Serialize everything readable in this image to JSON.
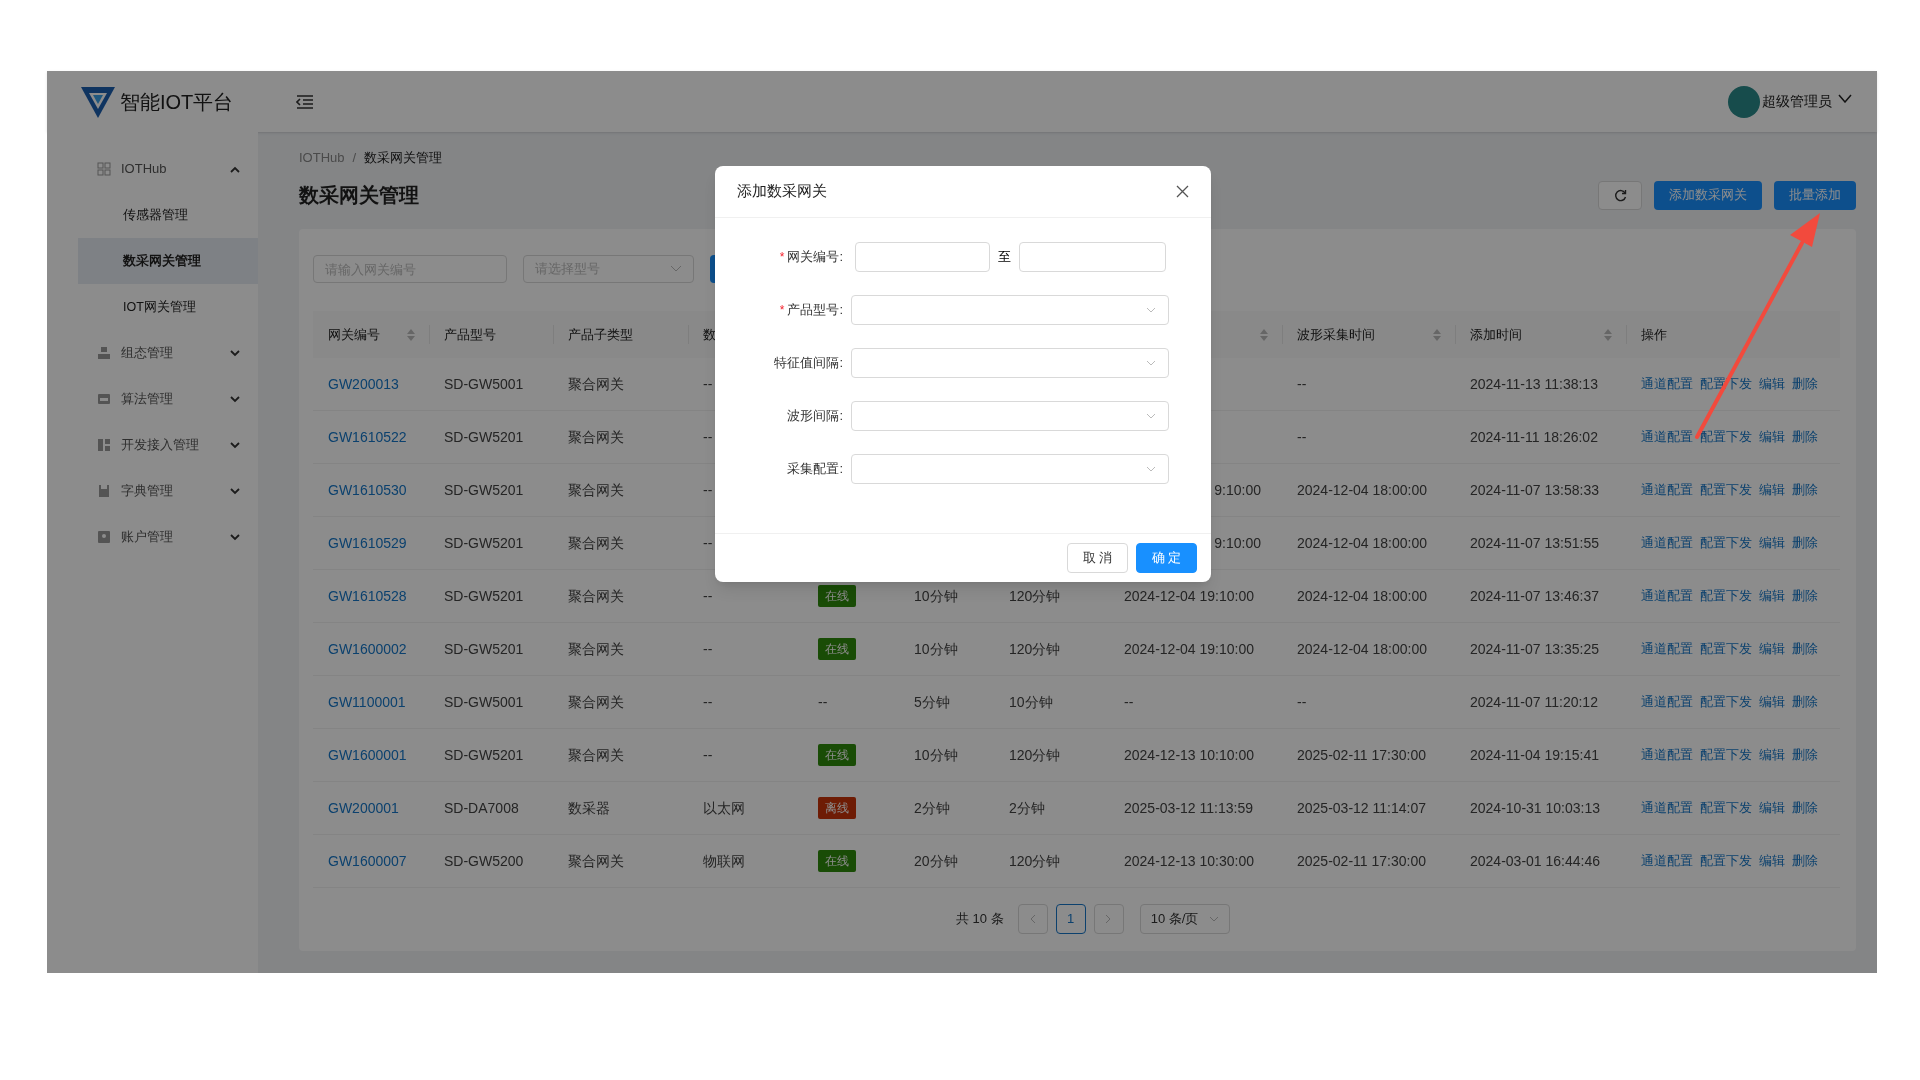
{
  "app": {
    "title": "智能IOT平台"
  },
  "user": {
    "name": "超级管理员"
  },
  "sidebar": {
    "items": [
      {
        "label": "IOTHub",
        "expanded": true,
        "children": [
          {
            "label": "传感器管理",
            "selected": false
          },
          {
            "label": "数采网关管理",
            "selected": true
          },
          {
            "label": "IOT网关管理",
            "selected": false
          }
        ]
      },
      {
        "label": "组态管理",
        "expanded": false
      },
      {
        "label": "算法管理",
        "expanded": false
      },
      {
        "label": "开发接入管理",
        "expanded": false
      },
      {
        "label": "字典管理",
        "expanded": false
      },
      {
        "label": "账户管理",
        "expanded": false
      }
    ]
  },
  "breadcrumb": {
    "items": [
      "IOTHub",
      "数采网关管理"
    ],
    "separator": "/"
  },
  "page_title": "数采网关管理",
  "toolbar_buttons": [
    {
      "label": "添加数采网关"
    },
    {
      "label": "批量添加"
    }
  ],
  "filters": {
    "gateway_placeholder": "请输入网关编号",
    "model_placeholder": "请选择型号"
  },
  "table": {
    "columns": [
      {
        "label": "网关编号",
        "sortable": true
      },
      {
        "label": "产品型号",
        "sortable": false
      },
      {
        "label": "产品子类型",
        "sortable": false
      },
      {
        "label": "数",
        "sortable": false
      },
      {},
      {},
      {},
      {
        "sortable": true
      },
      {
        "label": "波形采集时间",
        "sortable": true
      },
      {
        "label": "添加时间",
        "sortable": true
      },
      {
        "label": "操作",
        "sortable": false
      }
    ],
    "rows": [
      {
        "cells": [
          "GW200013",
          "SD-GW5001",
          "聚合网关",
          "--",
          null,
          null,
          null,
          null,
          "--",
          "2024-11-13 11:38:13"
        ],
        "actions": [
          "通道配置",
          "配置下发",
          "编辑",
          "删除"
        ]
      },
      {
        "cells": [
          "GW1610522",
          "SD-GW5201",
          "聚合网关",
          "--",
          null,
          null,
          null,
          null,
          "--",
          "2024-11-11 18:26:02"
        ],
        "actions": [
          "通道配置",
          "配置下发",
          "编辑",
          "删除"
        ]
      },
      {
        "cells": [
          "GW1610530",
          "SD-GW5201",
          "聚合网关",
          "--",
          null,
          null,
          null,
          {
            "text": "9:10:00",
            "cut": true
          },
          "2024-12-04 18:00:00",
          "2024-11-07 13:58:33"
        ],
        "actions": [
          "通道配置",
          "配置下发",
          "编辑",
          "删除"
        ]
      },
      {
        "cells": [
          "GW1610529",
          "SD-GW5201",
          "聚合网关",
          "--",
          null,
          null,
          null,
          {
            "text": "9:10:00",
            "cut": true
          },
          "2024-12-04 18:00:00",
          "2024-11-07 13:51:55"
        ],
        "actions": [
          "通道配置",
          "配置下发",
          "编辑",
          "删除"
        ]
      },
      {
        "cells": [
          "GW1610528",
          "SD-GW5201",
          "聚合网关",
          "--",
          {
            "tag": "在线",
            "kind": "online"
          },
          "10分钟",
          "120分钟",
          "2024-12-04 19:10:00",
          "2024-12-04 18:00:00",
          "2024-11-07 13:46:37"
        ],
        "actions": [
          "通道配置",
          "配置下发",
          "编辑",
          "删除"
        ]
      },
      {
        "cells": [
          "GW1600002",
          "SD-GW5201",
          "聚合网关",
          "--",
          {
            "tag": "在线",
            "kind": "online"
          },
          "10分钟",
          "120分钟",
          "2024-12-04 19:10:00",
          "2024-12-04 18:00:00",
          "2024-11-07 13:35:25"
        ],
        "actions": [
          "通道配置",
          "配置下发",
          "编辑",
          "删除"
        ]
      },
      {
        "cells": [
          "GW1100001",
          "SD-GW5001",
          "聚合网关",
          "--",
          "--",
          "5分钟",
          "10分钟",
          "--",
          "--",
          "2024-11-07 11:20:12"
        ],
        "actions": [
          "通道配置",
          "配置下发",
          "编辑",
          "删除"
        ]
      },
      {
        "cells": [
          "GW1600001",
          "SD-GW5201",
          "聚合网关",
          "--",
          {
            "tag": "在线",
            "kind": "online"
          },
          "10分钟",
          "120分钟",
          "2024-12-13 10:10:00",
          "2025-02-11 17:30:00",
          "2024-11-04 19:15:41"
        ],
        "actions": [
          "通道配置",
          "配置下发",
          "编辑",
          "删除"
        ]
      },
      {
        "cells": [
          "GW200001",
          "SD-DA7008",
          "数采器",
          "以太网",
          {
            "tag": "离线",
            "kind": "offline"
          },
          "2分钟",
          "2分钟",
          "2025-03-12 11:13:59",
          "2025-03-12 11:14:07",
          "2024-10-31 10:03:13"
        ],
        "actions": [
          "通道配置",
          "配置下发",
          "编辑",
          "删除"
        ]
      },
      {
        "cells": [
          "GW1600007",
          "SD-GW5200",
          "聚合网关",
          "物联网",
          {
            "tag": "在线",
            "kind": "online"
          },
          "20分钟",
          "120分钟",
          "2024-12-13 10:30:00",
          "2025-02-11 17:30:00",
          "2024-03-01 16:44:46"
        ],
        "actions": [
          "通道配置",
          "配置下发",
          "编辑",
          "删除"
        ]
      }
    ]
  },
  "pagination": {
    "total": "共 10 条",
    "pages": [
      {
        "label": "1",
        "selected": true
      }
    ],
    "page_size": "10 条/页"
  },
  "dialog": {
    "title": "添加数采网关",
    "fields": [
      {
        "label": "网关编号:",
        "required_mark": "*",
        "kind": "range",
        "separator": "至"
      },
      {
        "label": "产品型号:",
        "required_mark": "*",
        "kind": "select"
      },
      {
        "label": "特征值间隔:",
        "kind": "select"
      },
      {
        "label": "波形间隔:",
        "kind": "select"
      },
      {
        "label": "采集配置:",
        "kind": "select"
      }
    ],
    "buttons": [
      {
        "label": "取 消",
        "kind": "default"
      },
      {
        "label": "确 定",
        "kind": "primary"
      }
    ]
  }
}
